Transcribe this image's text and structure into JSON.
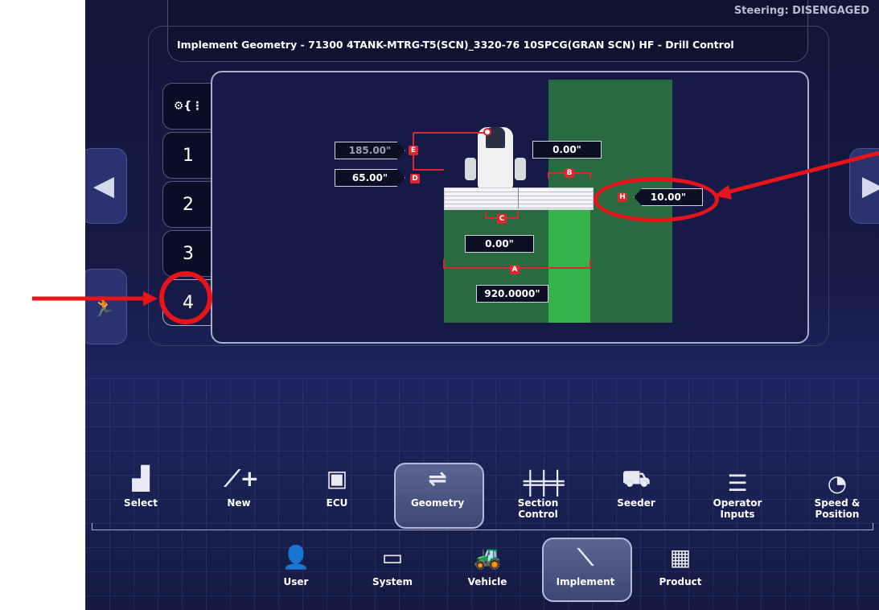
{
  "status": {
    "steering": "Steering: DISENGAGED"
  },
  "header": {
    "title": "Implement Geometry - 71300 4TANK-MTRG-T5(SCN)_3320-76 10SPCG(GRAN SCN) HF - Drill Control"
  },
  "tabs": [
    {
      "label": "⚙{⋮"
    },
    {
      "label": "1"
    },
    {
      "label": "2"
    },
    {
      "label": "3"
    },
    {
      "label": "4"
    }
  ],
  "geometry": {
    "E": {
      "letter": "E",
      "value": "185.00\""
    },
    "D": {
      "letter": "D",
      "value": "65.00\""
    },
    "B": {
      "letter": "B",
      "value": "0.00\""
    },
    "H": {
      "letter": "H",
      "value": "10.00\""
    },
    "C": {
      "letter": "C",
      "value": "0.00\""
    },
    "A": {
      "letter": "A",
      "value": "920.0000\""
    }
  },
  "toolbar": [
    {
      "label": "Select",
      "icon": "select-icon"
    },
    {
      "label": "New",
      "icon": "new-implement-icon"
    },
    {
      "label": "ECU",
      "icon": "ecu-icon"
    },
    {
      "label": "Geometry",
      "icon": "geometry-icon"
    },
    {
      "label": "Section\nControl",
      "icon": "section-control-icon"
    },
    {
      "label": "Seeder",
      "icon": "seeder-icon"
    },
    {
      "label": "Operator\nInputs",
      "icon": "operator-inputs-icon"
    },
    {
      "label": "Speed &\nPosition",
      "icon": "speed-position-icon"
    }
  ],
  "nav": [
    {
      "label": "User",
      "icon": "user-icon"
    },
    {
      "label": "System",
      "icon": "system-icon"
    },
    {
      "label": "Vehicle",
      "icon": "vehicle-icon"
    },
    {
      "label": "Implement",
      "icon": "implement-icon"
    },
    {
      "label": "Product",
      "icon": "product-icon"
    }
  ],
  "colors": {
    "field_dark": "#2a6a40",
    "field_light": "#36b34a",
    "annotation": "#e8141c"
  }
}
